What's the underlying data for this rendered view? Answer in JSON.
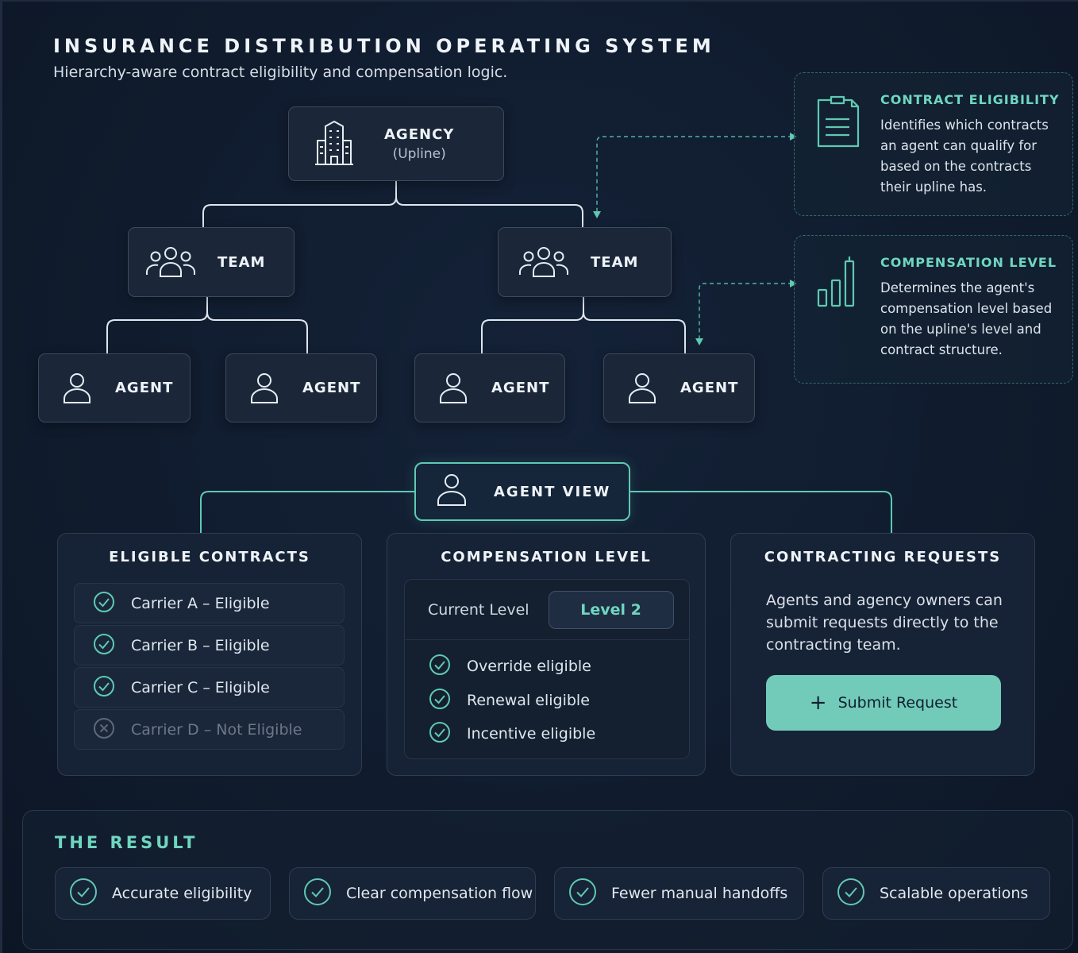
{
  "header": {
    "title": "INSURANCE DISTRIBUTION OPERATING SYSTEM",
    "subtitle": "Hierarchy-aware contract eligibility and compensation logic."
  },
  "hierarchy": {
    "agency": {
      "label": "AGENCY",
      "sublabel": "(Upline)",
      "icon": "building-icon"
    },
    "teams": [
      {
        "label": "TEAM",
        "icon": "team-icon"
      },
      {
        "label": "TEAM",
        "icon": "team-icon"
      }
    ],
    "agents": [
      {
        "label": "AGENT",
        "icon": "user-icon"
      },
      {
        "label": "AGENT",
        "icon": "user-icon"
      },
      {
        "label": "AGENT",
        "icon": "user-icon"
      },
      {
        "label": "AGENT",
        "icon": "user-icon"
      }
    ]
  },
  "callouts": [
    {
      "title": "CONTRACT ELIGIBILITY",
      "text": "Identifies which contracts an agent can qualify for based on the contracts their upline has.",
      "icon": "document-icon"
    },
    {
      "title": "COMPENSATION LEVEL",
      "text": "Determines the agent's compensation level based on the upline's level and contract structure.",
      "icon": "bar-chart-icon"
    }
  ],
  "agent_view": {
    "label": "AGENT VIEW",
    "icon": "user-icon"
  },
  "eligible_contracts": {
    "title": "ELIGIBLE CONTRACTS",
    "items": [
      {
        "text": "Carrier A – Eligible",
        "status": "eligible"
      },
      {
        "text": "Carrier B – Eligible",
        "status": "eligible"
      },
      {
        "text": "Carrier C – Eligible",
        "status": "eligible"
      },
      {
        "text": "Carrier D – Not Eligible",
        "status": "not-eligible"
      }
    ]
  },
  "compensation": {
    "title": "COMPENSATION LEVEL",
    "current_label": "Current Level",
    "current_value": "Level 2",
    "items": [
      "Override eligible",
      "Renewal eligible",
      "Incentive eligible"
    ]
  },
  "requests": {
    "title": "CONTRACTING REQUESTS",
    "text": "Agents and agency owners can submit requests directly to the contracting team.",
    "button_label": "Submit Request"
  },
  "result": {
    "title": "THE RESULT",
    "items": [
      "Accurate eligibility",
      "Clear compensation flow",
      "Fewer manual handoffs",
      "Scalable operations"
    ]
  },
  "colors": {
    "background": "#0f1a2b",
    "accent": "#6fd6c0",
    "button": "#72cbb9",
    "node_fill": "#1b2739",
    "node_border": "#3a4a60"
  }
}
